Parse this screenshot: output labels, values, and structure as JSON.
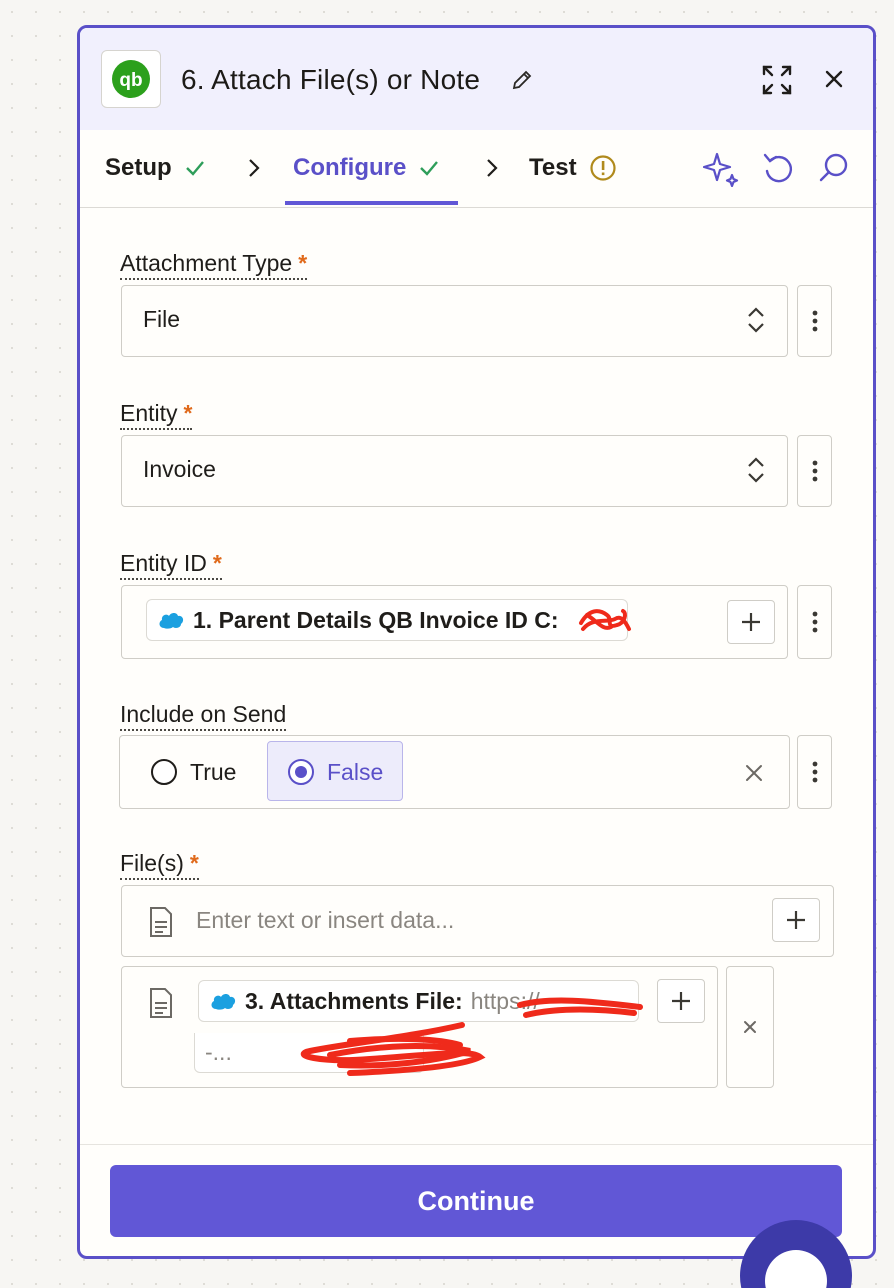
{
  "header": {
    "title": "6. Attach File(s) or Note",
    "app_icon": "quickbooks-logo",
    "actions": [
      "edit-icon",
      "expand-icon",
      "close-icon"
    ]
  },
  "tabs": [
    {
      "label": "Setup",
      "status": "complete"
    },
    {
      "label": "Configure",
      "status": "complete",
      "active": true
    },
    {
      "label": "Test",
      "status": "warning"
    }
  ],
  "toolbar_icons": [
    "sparkle-icon",
    "undo-icon",
    "search-icon"
  ],
  "fields": {
    "attachment_type": {
      "label": "Attachment Type",
      "required": "*",
      "value": "File"
    },
    "entity": {
      "label": "Entity",
      "required": "*",
      "value": "Invoice"
    },
    "entity_id": {
      "label": "Entity ID",
      "required": "*",
      "pill_text": "1. Parent Details QB Invoice ID C:"
    },
    "include_on_send": {
      "label": "Include on Send",
      "options": [
        "True",
        "False"
      ],
      "selected": "False"
    },
    "files": {
      "label": "File(s)",
      "required": "*",
      "placeholder": "Enter text or insert data...",
      "item_pill_text": "3. Attachments File:",
      "item_url_prefix": "https://",
      "item_url_suffix": "-..."
    }
  },
  "continue_button": "Continue",
  "colors": {
    "accent": "#6157d6",
    "border": "#5a50c8",
    "required": "#e06a1b",
    "check": "#2e9e5a",
    "warning": "#b08a1c"
  }
}
